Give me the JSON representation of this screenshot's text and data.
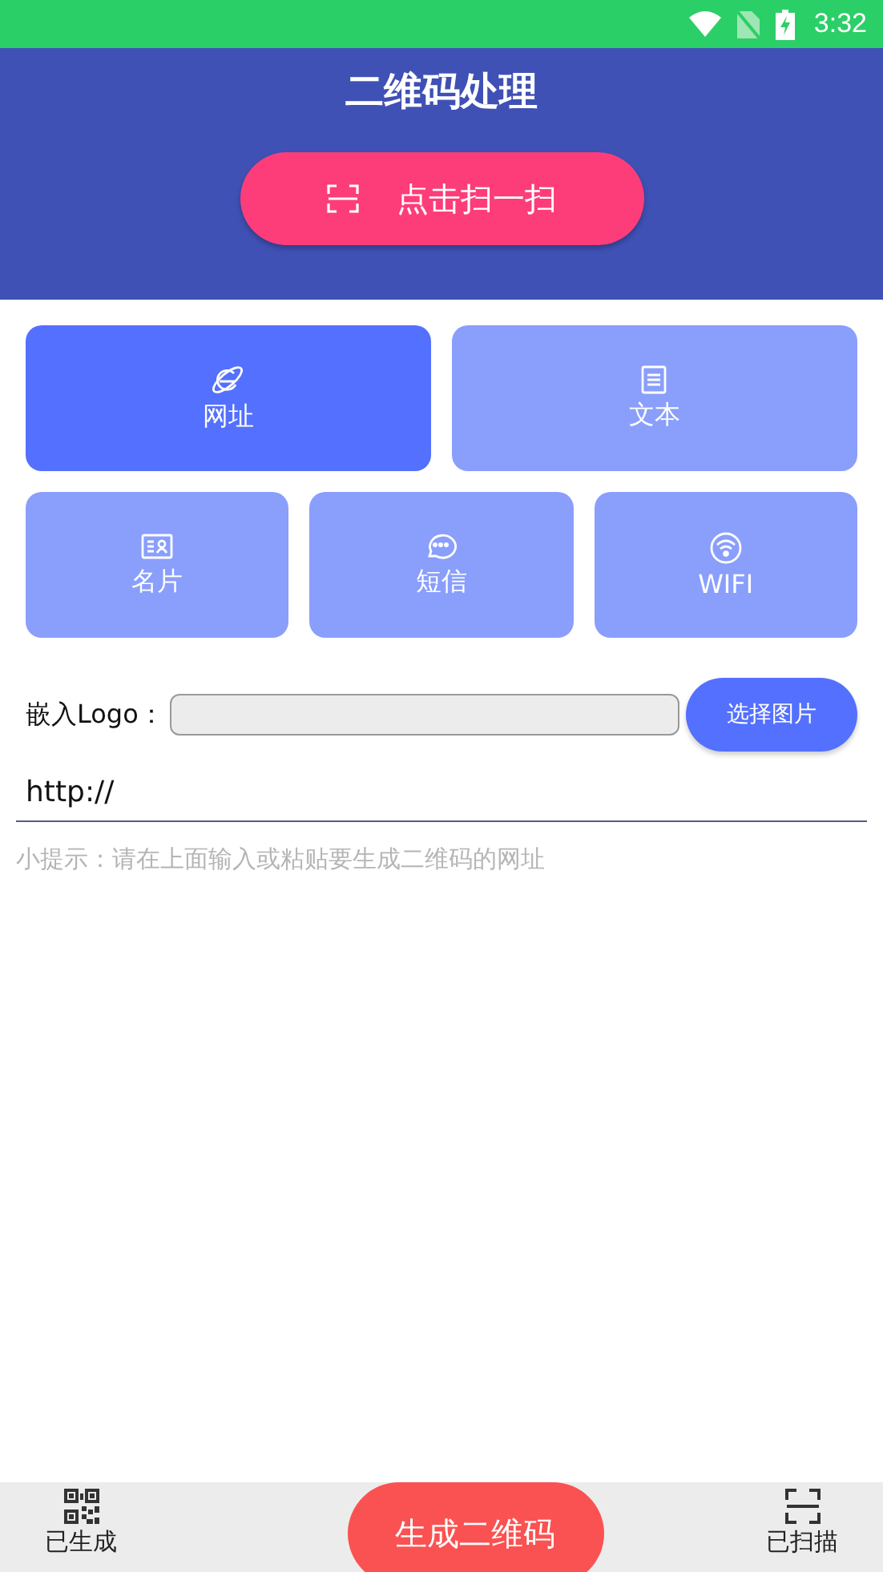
{
  "status_bar": {
    "time": "3:32"
  },
  "header": {
    "title": "二维码处理",
    "scan_button": "点击扫一扫"
  },
  "categories": [
    {
      "label": "网址",
      "selected": true
    },
    {
      "label": "文本",
      "selected": false
    },
    {
      "label": "名片",
      "selected": false
    },
    {
      "label": "短信",
      "selected": false
    },
    {
      "label": "WIFI",
      "selected": false
    }
  ],
  "logo": {
    "label": "嵌入Logo：",
    "button": "选择图片"
  },
  "url_field": {
    "value": "http://"
  },
  "hint": "小提示：请在上面输入或粘贴要生成二维码的网址",
  "bottom_nav": {
    "left": "已生成",
    "center": "生成二维码",
    "right": "已扫描"
  }
}
